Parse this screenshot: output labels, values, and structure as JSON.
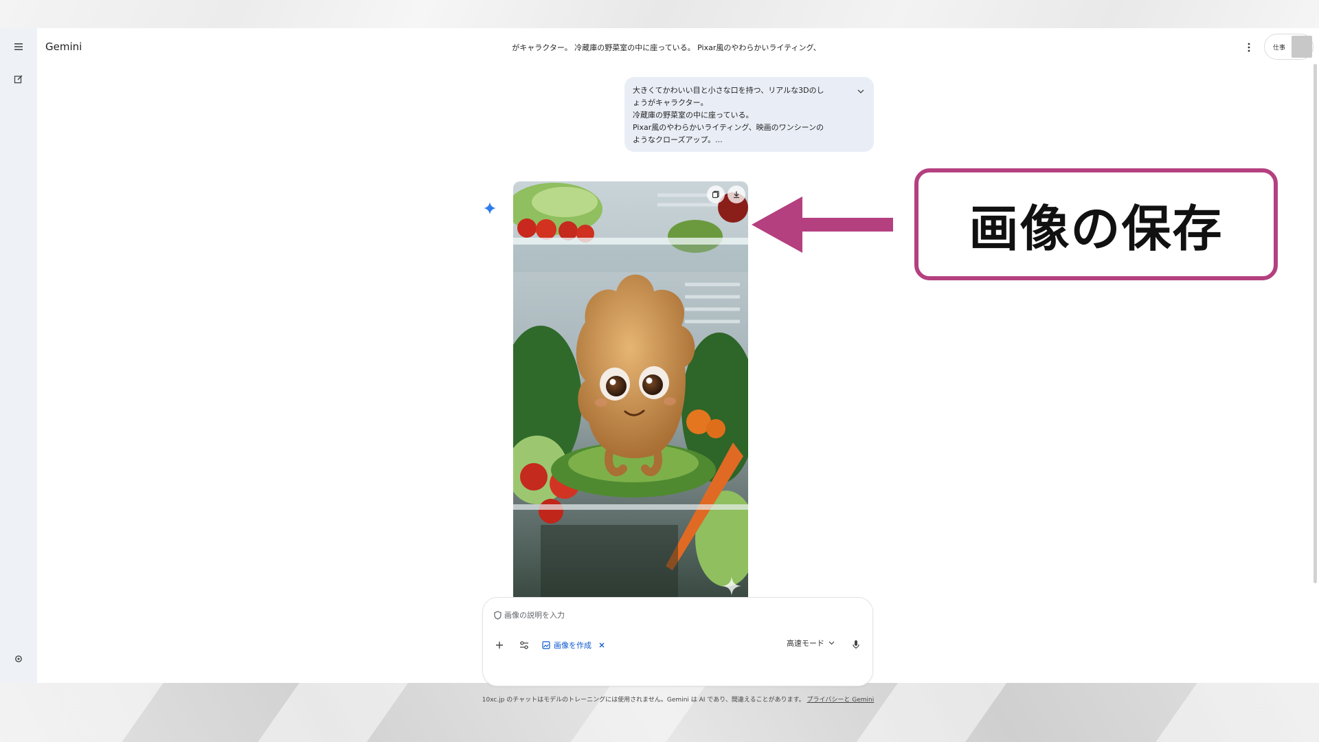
{
  "app": {
    "name": "Gemini",
    "chat_title": "がキャラクター。 冷蔵庫の野菜室の中に座っている。 Pixar風のやわらかいライティング、",
    "workspace_label": "仕事"
  },
  "prompt": {
    "lines": [
      "大きくてかわいい目と小さな口を持つ、リアルな3Dのし",
      "ょうがキャラクター。",
      "冷蔵庫の野菜室の中に座っている。",
      "Pixar風のやわらかいライティング、映画のワンシーンの",
      "ようなクローズアップ。..."
    ]
  },
  "callout": {
    "text": "画像の保存",
    "color": "#b4407f"
  },
  "composer": {
    "placeholder": "画像の説明を入力",
    "tool_chip": "画像を作成",
    "mode": "高速モード"
  },
  "footer": {
    "disclaimer": "10xc.jp のチャットはモデルのトレーニングには使用されません。Gemini は AI であり、間違えることがあります。",
    "privacy_link": "プライバシーと Gemini"
  },
  "icons": {
    "menu": "menu-icon",
    "new_chat": "edit-icon",
    "settings": "settings-icon",
    "more": "more-vert-icon",
    "sparkle": "gemini-sparkle-icon",
    "copy": "copy-icon",
    "download": "download-icon",
    "add": "plus-icon",
    "tools": "tune-icon",
    "mic": "mic-icon"
  },
  "colors": {
    "accent": "#0b57d0",
    "rail_bg": "#eef2f7",
    "bubble_bg": "#e9eef6"
  }
}
